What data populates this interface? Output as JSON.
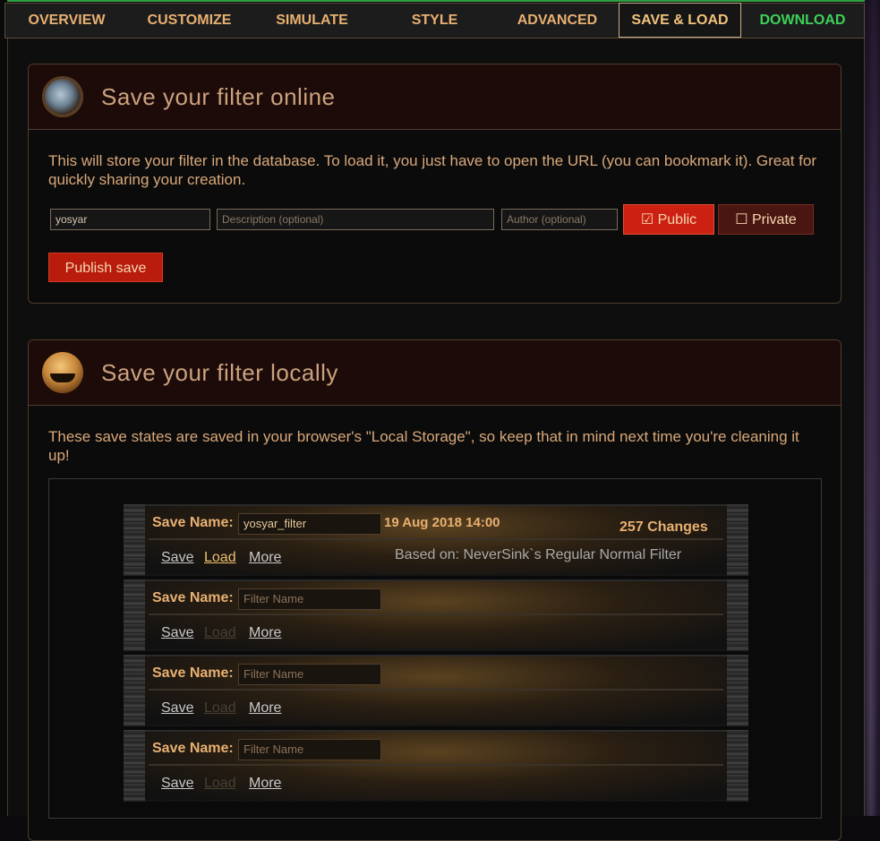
{
  "tabs": [
    {
      "label": "OVERVIEW"
    },
    {
      "label": "CUSTOMIZE"
    },
    {
      "label": "SIMULATE"
    },
    {
      "label": "STYLE"
    },
    {
      "label": "ADVANCED"
    },
    {
      "label": "SAVE & LOAD"
    },
    {
      "label": "DOWNLOAD"
    }
  ],
  "active_tab": "SAVE & LOAD",
  "online": {
    "title": "Save your filter online",
    "description": "This will store your filter in the database. To load it, you just have to open the URL (you can bookmark it). Great for quickly sharing your creation.",
    "name_value": "yosyar",
    "description_placeholder": "Description (optional)",
    "author_placeholder": "Author (optional)",
    "public_label": "☑ Public",
    "private_label": "☐ Private",
    "publish_label": "Publish save"
  },
  "local": {
    "title": "Save your filter locally",
    "description": "These save states are saved in your browser's \"Local Storage\", so keep that in mind next time you're cleaning it up!",
    "slots": [
      {
        "label": "Save Name:",
        "name": "yosyar_filter",
        "date": "19 Aug 2018 14:00",
        "changes": "257 Changes",
        "based_on": "Based on: NeverSink`s Regular Normal Filter",
        "save": "Save",
        "load": "Load",
        "more": "More",
        "load_enabled": true
      },
      {
        "label": "Save Name:",
        "name": "",
        "placeholder": "Filter Name",
        "save": "Save",
        "load": "Load",
        "more": "More",
        "load_enabled": false
      },
      {
        "label": "Save Name:",
        "name": "",
        "placeholder": "Filter Name",
        "save": "Save",
        "load": "Load",
        "more": "More",
        "load_enabled": false
      },
      {
        "label": "Save Name:",
        "name": "",
        "placeholder": "Filter Name",
        "save": "Save",
        "load": "Load",
        "more": "More",
        "load_enabled": false
      }
    ]
  },
  "colors": {
    "accent": "#e8b071",
    "download": "#3ed158",
    "publish": "#b91c0d"
  }
}
